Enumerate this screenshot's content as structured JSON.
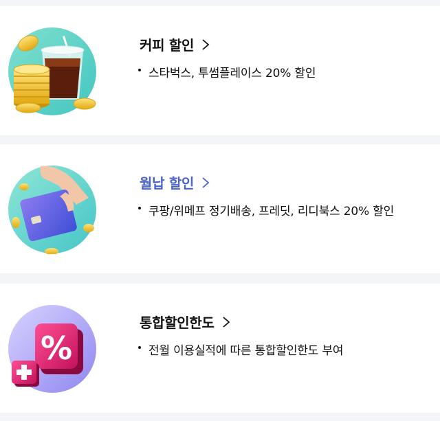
{
  "benefits": [
    {
      "title": "커피 할인",
      "detail": "스타벅스, 투썸플레이스 20% 할인",
      "icon": "coffee-coins-icon",
      "title_color": "#111111"
    },
    {
      "title": "월납 할인",
      "detail": "쿠팡/위메프 정기배송, 프레딧, 리디북스 20% 할인",
      "icon": "hand-card-icon",
      "title_color": "#4a63c9"
    },
    {
      "title": "통합할인한도",
      "detail": "전월 이용실적에 따른 통합할인한도 부여",
      "icon": "percent-plus-icon",
      "title_color": "#111111"
    }
  ],
  "colors": {
    "page_bg": "#f3f5f9",
    "card_bg": "#ffffff",
    "accent": "#4a63c9"
  }
}
